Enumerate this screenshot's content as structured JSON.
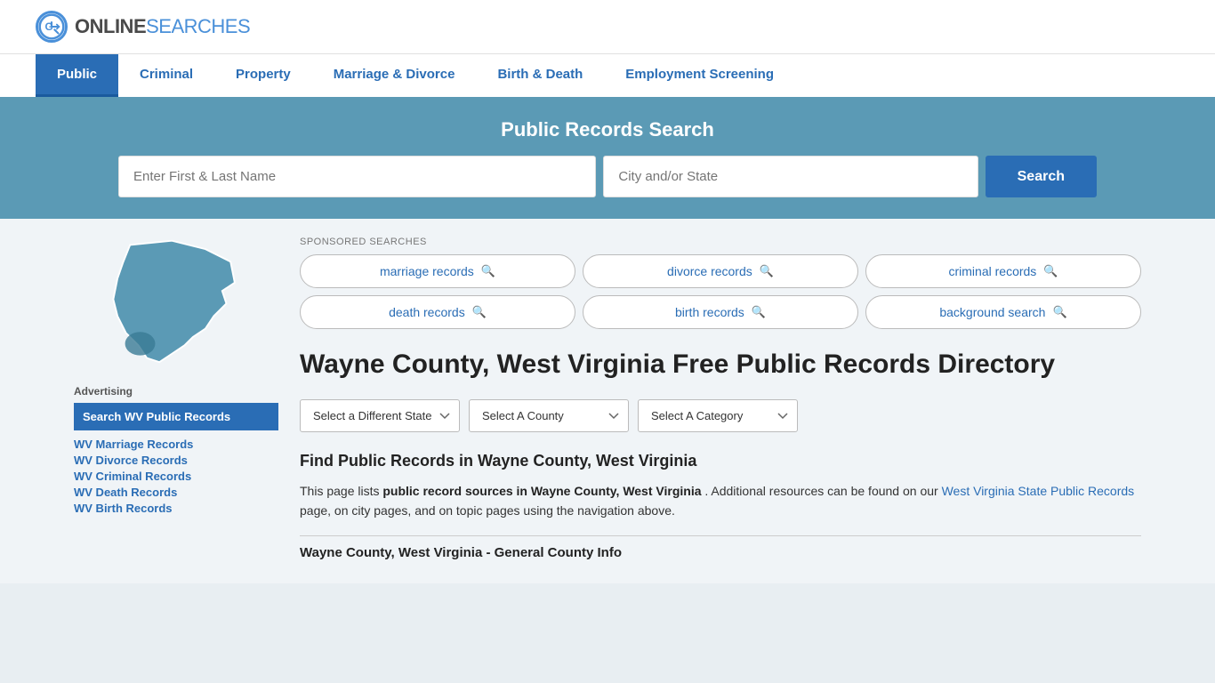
{
  "site": {
    "logo_online": "ONLINE",
    "logo_searches": "SEARCHES"
  },
  "nav": {
    "items": [
      {
        "label": "Public",
        "active": true
      },
      {
        "label": "Criminal",
        "active": false
      },
      {
        "label": "Property",
        "active": false
      },
      {
        "label": "Marriage & Divorce",
        "active": false
      },
      {
        "label": "Birth & Death",
        "active": false
      },
      {
        "label": "Employment Screening",
        "active": false
      }
    ]
  },
  "banner": {
    "title": "Public Records Search",
    "name_placeholder": "Enter First & Last Name",
    "city_placeholder": "City and/or State",
    "search_label": "Search"
  },
  "sponsored": {
    "label": "SPONSORED SEARCHES",
    "items": [
      {
        "text": "marriage records"
      },
      {
        "text": "divorce records"
      },
      {
        "text": "criminal records"
      },
      {
        "text": "death records"
      },
      {
        "text": "birth records"
      },
      {
        "text": "background search"
      }
    ]
  },
  "sidebar": {
    "ad_label": "Advertising",
    "ad_item_label": "Search WV Public Records",
    "links": [
      {
        "text": "WV Marriage Records"
      },
      {
        "text": "WV Divorce Records"
      },
      {
        "text": "WV Criminal Records"
      },
      {
        "text": "WV Death Records"
      },
      {
        "text": "WV Birth Records"
      }
    ]
  },
  "content": {
    "county_title": "Wayne County, West Virginia Free Public Records Directory",
    "dropdowns": {
      "state_label": "Select a Different State",
      "county_label": "Select A County",
      "category_label": "Select A Category"
    },
    "find_title": "Find Public Records in Wayne County, West Virginia",
    "find_desc_1": "This page lists ",
    "find_desc_bold": "public record sources in Wayne County, West Virginia",
    "find_desc_2": ". Additional resources can be found on our ",
    "find_desc_link": "West Virginia State Public Records",
    "find_desc_3": " page, on city pages, and on topic pages using the navigation above.",
    "county_info_title": "Wayne County, West Virginia - General County Info"
  }
}
